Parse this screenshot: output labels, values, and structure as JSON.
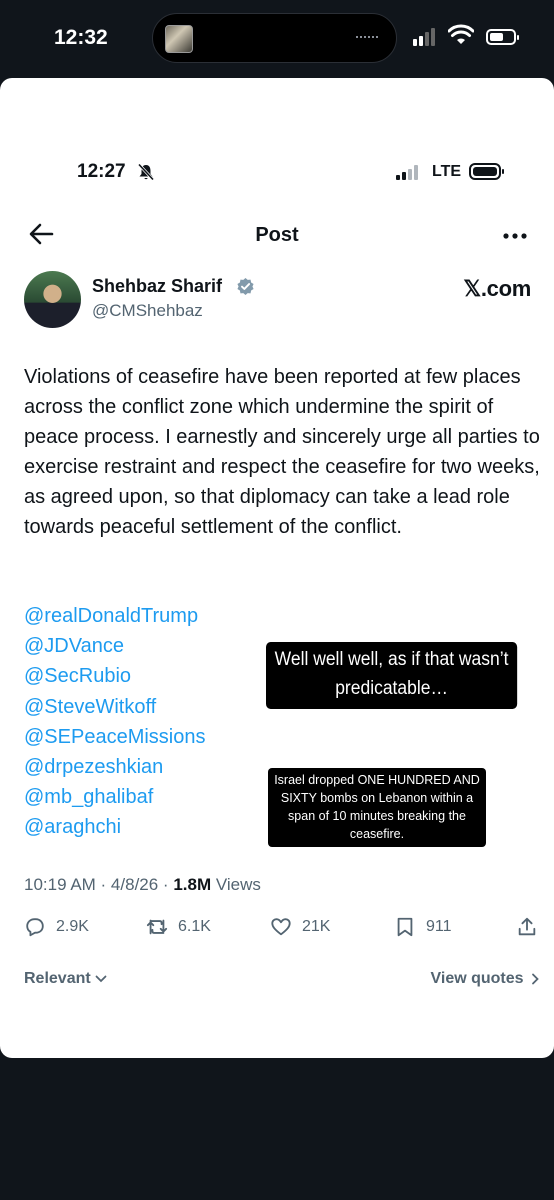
{
  "outer_status": {
    "time": "12:32"
  },
  "inner_status": {
    "time": "12:27",
    "network": "LTE"
  },
  "header": {
    "title": "Post"
  },
  "post": {
    "author_name": "Shehbaz Sharif",
    "handle": "@CMShehbaz",
    "source_label": "𝕏.com",
    "body": "Violations of ceasefire have been reported at few places across the conflict zone which undermine the spirit of peace process. I earnestly and sincerely urge all parties to exercise restraint and respect the ceasefire for two weeks, as agreed upon, so that diplomacy can take a lead role towards peaceful settlement of the conflict.",
    "mentions": [
      "@realDonaldTrump",
      "@JDVance",
      "@SecRubio",
      "@SteveWitkoff",
      "@SEPeaceMissions",
      "@drpezeshkian",
      "@mb_ghalibaf",
      "@araghchi"
    ],
    "timestamp": "10:19 AM · 4/8/26 · ",
    "views_count": "1.8M",
    "views_label": " Views"
  },
  "actions": {
    "replies": "2.9K",
    "reposts": "6.1K",
    "likes": "21K",
    "bookmarks": "911"
  },
  "footer": {
    "sort_label": "Relevant",
    "view_quotes": "View quotes"
  },
  "overlays": {
    "note_1": "Well well well, as if that wasn’t predicatable…",
    "note_2": "Israel dropped ONE HUNDRED AND SIXTY bombs on Lebanon within a span of 10 minutes breaking the ceasefire."
  },
  "colors": {
    "link": "#1d9bf0",
    "secondary_text": "#536471",
    "background": "#10151b"
  }
}
